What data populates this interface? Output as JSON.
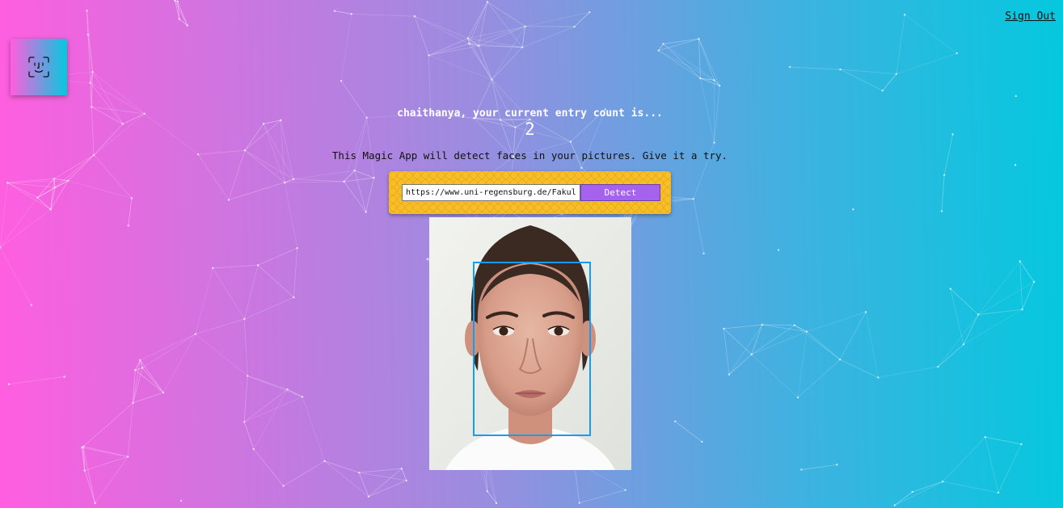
{
  "header": {
    "signout_label": "Sign Out"
  },
  "logo": {
    "icon": "face-id-icon"
  },
  "entry": {
    "greeting": "chaithanya, your current entry count is...",
    "count": "2"
  },
  "app": {
    "tagline": "This Magic App will detect faces in your pictures. Give it a try."
  },
  "form": {
    "url_value": "https://www.uni-regensburg.de/Fakultaeten/phil_Fak_II/Psychologie/Psy_II/beautycheck/english/durchschnittsgesichter/m(01-32).jpg",
    "detect_label": "Detect"
  },
  "result": {
    "image_alt": "face-photo",
    "faces_detected": 1
  },
  "colors": {
    "gradient_start": "#ff5edf",
    "gradient_end": "#04c8de",
    "panel": "#f9bd26",
    "button": "#a562ee",
    "box": "#149df2"
  }
}
